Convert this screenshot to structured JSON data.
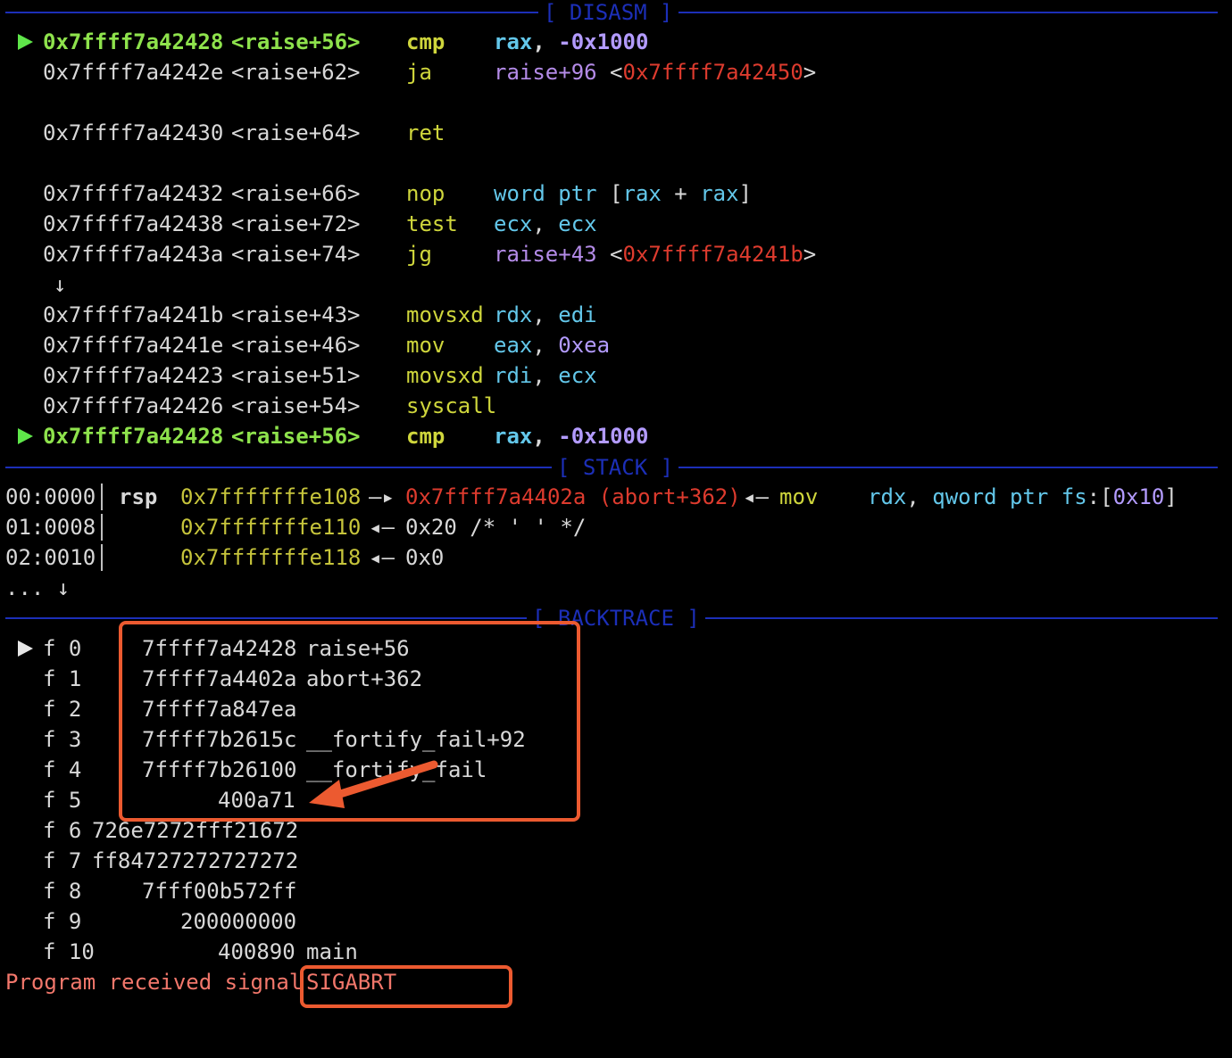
{
  "disasm": {
    "title": "[ DISASM ]",
    "current": {
      "addr": "0x7ffff7a42428",
      "sym": "<raise+56>",
      "mnem": "cmp",
      "op_a": "rax",
      "op_sep": ", ",
      "op_b": "-0x1000"
    },
    "lines": [
      {
        "addr": "0x7ffff7a4242e",
        "sym": "<raise+62>",
        "mnem": "ja",
        "op_target": "raise+96",
        "lt": "<",
        "op_addr": "0x7ffff7a42450",
        "gt": ">"
      },
      {
        "addr": "0x7ffff7a42430",
        "sym": "<raise+64>",
        "mnem": "ret"
      },
      {
        "addr": "0x7ffff7a42432",
        "sym": "<raise+66>",
        "mnem": "nop",
        "op_ptr": "word ptr",
        "op_lb": "[",
        "op_r1": "rax",
        "op_plus": " + ",
        "op_r2": "rax",
        "op_rb": "]"
      },
      {
        "addr": "0x7ffff7a42438",
        "sym": "<raise+72>",
        "mnem": "test",
        "op_a": "ecx",
        "op_sep": ", ",
        "op_b": "ecx"
      },
      {
        "addr": "0x7ffff7a4243a",
        "sym": "<raise+74>",
        "mnem": "jg",
        "op_target": "raise+43",
        "lt": "<",
        "op_addr": "0x7ffff7a4241b",
        "gt": ">"
      },
      {
        "addr": "0x7ffff7a4241b",
        "sym": "<raise+43>",
        "mnem": "movsxd",
        "op_a": "rdx",
        "op_sep": ", ",
        "op_b": "edi"
      },
      {
        "addr": "0x7ffff7a4241e",
        "sym": "<raise+46>",
        "mnem": "mov",
        "op_a": "eax",
        "op_sep": ", ",
        "op_b": "0xea"
      },
      {
        "addr": "0x7ffff7a42423",
        "sym": "<raise+51>",
        "mnem": "movsxd",
        "op_a": "rdi",
        "op_sep": ", ",
        "op_b": "ecx"
      },
      {
        "addr": "0x7ffff7a42426",
        "sym": "<raise+54>",
        "mnem": "syscall"
      }
    ],
    "jump_arrow": "↓"
  },
  "stack": {
    "title": "[ STACK ]",
    "rows": [
      {
        "offset": "00:0000",
        "reg": "rsp",
        "addr": "0x7fffffffe108",
        "arrow": "—▸",
        "target": "0x7ffff7a4402a (abort+362)",
        "back": "◂—",
        "mnem": "mov",
        "op_a": "rdx",
        "op_sep": ", ",
        "op_ptr": "qword ptr",
        "op_seg": "fs",
        "op_colon": ":",
        "op_lb": "[",
        "op_off": "0x10",
        "op_rb": "]"
      },
      {
        "offset": "01:0008",
        "addr": "0x7fffffffe110",
        "back": "◂—",
        "value": "0x20 /* ' ' */"
      },
      {
        "offset": "02:0010",
        "addr": "0x7fffffffe118",
        "back": "◂—",
        "value": "0x0"
      }
    ],
    "more": "... ↓"
  },
  "backtrace": {
    "title": "[ BACKTRACE ]",
    "frames": [
      {
        "id": "f 0",
        "addr": "7ffff7a42428",
        "sym": "raise+56"
      },
      {
        "id": "f 1",
        "addr": "7ffff7a4402a",
        "sym": "abort+362"
      },
      {
        "id": "f 2",
        "addr": "7ffff7a847ea",
        "sym": ""
      },
      {
        "id": "f 3",
        "addr": "7ffff7b2615c",
        "sym": "__fortify_fail+92"
      },
      {
        "id": "f 4",
        "addr": "7ffff7b26100",
        "sym": "__fortify_fail"
      },
      {
        "id": "f 5",
        "addr": "400a71",
        "sym": ""
      },
      {
        "id": "f 6",
        "addr": "726e7272fff21672",
        "sym": ""
      },
      {
        "id": "f 7",
        "addr": "ff84727272727272",
        "sym": ""
      },
      {
        "id": "f 8",
        "addr": "7fff00b572ff",
        "sym": ""
      },
      {
        "id": "f 9",
        "addr": "200000000",
        "sym": ""
      },
      {
        "id": "f 10",
        "addr": "400890",
        "sym": "main"
      }
    ]
  },
  "signal": {
    "prefix": "Program received signal ",
    "name": "SIGABRT"
  },
  "colors": {
    "separator": "#1c2fb8",
    "highlight_box": "#ec5a30",
    "current_line": "#8ee24c",
    "mnemonic": "#cfd63c",
    "register": "#63c7ea",
    "immediate": "#b39bff",
    "jump_addr": "#dd3b2e",
    "stack_addr": "#c6c43b",
    "signal_text": "#f2776b"
  }
}
